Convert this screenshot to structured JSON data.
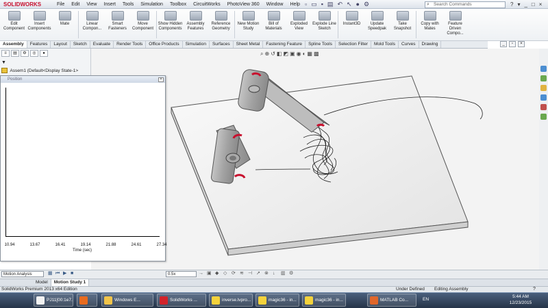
{
  "app": {
    "logo": "SOLIDWORKS"
  },
  "menu": [
    "File",
    "Edit",
    "View",
    "Insert",
    "Tools",
    "Simulation",
    "Toolbox",
    "CircuitWorks",
    "PhotoView 360",
    "Window",
    "Help"
  ],
  "search": {
    "placeholder": "Search Commands"
  },
  "help_icons": [
    "?",
    "▾",
    "_",
    "□",
    "×"
  ],
  "commands": [
    {
      "label": "Edit Component",
      "icon": "edit-component-icon"
    },
    {
      "label": "Insert Components",
      "icon": "insert-components-icon"
    },
    {
      "label": "Mate",
      "icon": "mate-icon"
    },
    {
      "label": "Linear Compon...",
      "icon": "linear-pattern-icon"
    },
    {
      "label": "Smart Fasteners",
      "icon": "smart-fasteners-icon"
    },
    {
      "label": "Move Component",
      "icon": "move-component-icon"
    },
    {
      "label": "Show Hidden Components",
      "icon": "show-hidden-icon"
    },
    {
      "label": "Assembly Features",
      "icon": "assembly-features-icon"
    },
    {
      "label": "Reference Geometry",
      "icon": "reference-geometry-icon"
    },
    {
      "label": "New Motion Study",
      "icon": "motion-study-icon"
    },
    {
      "label": "Bill of Materials",
      "icon": "bom-icon"
    },
    {
      "label": "Exploded View",
      "icon": "exploded-view-icon"
    },
    {
      "label": "Explode Line Sketch",
      "icon": "explode-line-icon"
    },
    {
      "label": "Instant3D",
      "icon": "instant3d-icon"
    },
    {
      "label": "Update Speedpak",
      "icon": "speedpak-icon"
    },
    {
      "label": "Take Snapshot",
      "icon": "snapshot-icon"
    },
    {
      "label": "Copy with Mates",
      "icon": "copy-mates-icon"
    },
    {
      "label": "Feature Driven Compo...",
      "icon": "feature-driven-icon"
    }
  ],
  "tabs": [
    "Assembly",
    "Features",
    "Layout",
    "Sketch",
    "Evaluate",
    "Render Tools",
    "Office Products",
    "Simulation",
    "Surfaces",
    "Sheet Metal",
    "Fastening Feature",
    "Spline Tools",
    "Selection Filter",
    "Mold Tools",
    "Curves",
    "Drawing"
  ],
  "active_tab": "Assembly",
  "tree": {
    "filter": "▼",
    "item": "Assem1  (Default<Display State-1>"
  },
  "graph": {
    "title": "Position",
    "x_ticks": [
      "10.94",
      "13.67",
      "16.41",
      "19.14",
      "21.88",
      "24.61",
      "27.34"
    ],
    "xlabel": "Time (sec)"
  },
  "motion": {
    "study_type": "Motion Analysis",
    "speed": "0.5x",
    "tabs": [
      "Model",
      "Motion Study 1"
    ],
    "active_tab": "Motion Study 1"
  },
  "status": {
    "left": "SolidWorks Premium 2013 x64 Edition",
    "defined": "Under Defined",
    "editing": "Editing Assembly",
    "help": "?"
  },
  "taskbar": {
    "items": [
      {
        "label": "PJ11[00:1e7...",
        "color": "#f2f2f2"
      },
      {
        "label": "",
        "color": "#e86b1f"
      },
      {
        "label": "Windows E...",
        "color": "#f1c44a"
      },
      {
        "label": "SolidWorks ...",
        "color": "#d2232a"
      },
      {
        "label": "inverse.lvpro...",
        "color": "#f4d23b"
      },
      {
        "label": "magic36 - in...",
        "color": "#f4d23b"
      },
      {
        "label": "magic36 - in...",
        "color": "#f4d23b"
      },
      {
        "label": "MATLAB Co...",
        "color": "#e0662a"
      }
    ],
    "lang": "EN",
    "time": "5:44 AM",
    "date": "12/23/2015"
  }
}
